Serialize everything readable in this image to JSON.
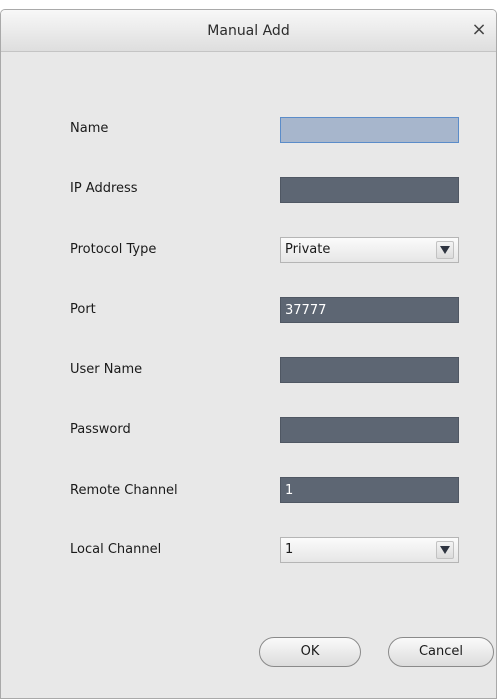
{
  "dialog": {
    "title": "Manual Add",
    "close_glyph": "×"
  },
  "fields": {
    "name": {
      "label": "Name",
      "value": ""
    },
    "ip_address": {
      "label": "IP Address",
      "value": ""
    },
    "protocol_type": {
      "label": "Protocol Type",
      "value": "Private"
    },
    "port": {
      "label": "Port",
      "value": "37777"
    },
    "user_name": {
      "label": "User Name",
      "value": ""
    },
    "password": {
      "label": "Password",
      "value": ""
    },
    "remote_channel": {
      "label": "Remote Channel",
      "value": "1"
    },
    "local_channel": {
      "label": "Local Channel",
      "value": "1"
    }
  },
  "buttons": {
    "ok": "OK",
    "cancel": "Cancel"
  },
  "icons": {
    "close": "close-icon",
    "dropdown": "chevron-down-icon"
  },
  "colors": {
    "field_background": "#5d6673",
    "focused_field_background": "#a7b6cc",
    "dialog_background": "#e8e8e8"
  }
}
